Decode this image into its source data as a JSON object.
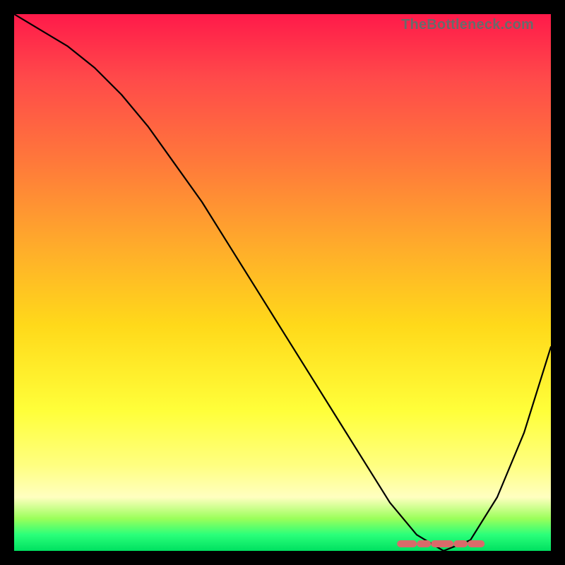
{
  "watermark_text": "TheBottleneck.com",
  "colors": {
    "background": "#000000",
    "watermark": "#6a6a6a",
    "curve": "#000000",
    "lowband": "#d96a6a",
    "gradient_stops": [
      "#ff1a4a",
      "#ff4a4a",
      "#ff7a3a",
      "#ffae2a",
      "#ffd91a",
      "#ffff3a",
      "#ffff80",
      "#ffffc0",
      "#9aff5a",
      "#2aff7a",
      "#00e060"
    ]
  },
  "chart_data": {
    "type": "line",
    "title": "",
    "xlabel": "",
    "ylabel": "",
    "xlim": [
      0,
      100
    ],
    "ylim": [
      0,
      100
    ],
    "series": [
      {
        "name": "bottleneck-curve",
        "x": [
          0,
          5,
          10,
          15,
          20,
          25,
          30,
          35,
          40,
          45,
          50,
          55,
          60,
          65,
          70,
          75,
          80,
          85,
          90,
          95,
          100
        ],
        "y": [
          100,
          97,
          94,
          90,
          85,
          79,
          72,
          65,
          57,
          49,
          41,
          33,
          25,
          17,
          9,
          3,
          0,
          2,
          10,
          22,
          38
        ]
      }
    ],
    "annotations": [
      {
        "name": "optimal-range",
        "x_start": 72,
        "x_end": 87,
        "y": 0
      }
    ]
  }
}
